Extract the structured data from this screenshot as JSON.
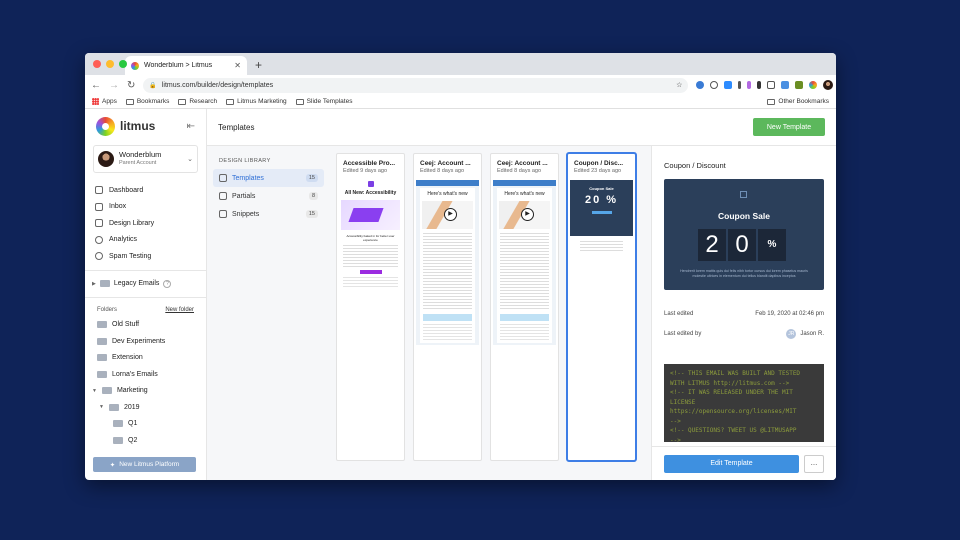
{
  "browser": {
    "tab_title": "Wonderblum > Litmus",
    "url": "litmus.com/builder/design/templates",
    "bookmarks": [
      "Apps",
      "Bookmarks",
      "Research",
      "Litmus Marketing",
      "Slide Templates"
    ],
    "other_bookmarks": "Other Bookmarks"
  },
  "sidebar": {
    "logo_text": "litmus",
    "account_name": "Wonderblum",
    "account_sub": "Parent Account",
    "nav": [
      "Dashboard",
      "Inbox",
      "Design Library",
      "Analytics",
      "Spam Testing"
    ],
    "legacy": "Legacy Emails",
    "folders_label": "Folders",
    "new_folder": "New folder",
    "folders": [
      "Old Stuff",
      "Dev Experiments",
      "Extension",
      "Lorna's Emails",
      "Marketing",
      "2019",
      "Q1",
      "Q2"
    ],
    "new_platform": "New Litmus Platform"
  },
  "topbar": {
    "title": "Templates",
    "new_template": "New Template"
  },
  "library": {
    "heading": "DESIGN LIBRARY",
    "items": [
      {
        "label": "Templates",
        "count": "15"
      },
      {
        "label": "Partials",
        "count": "8"
      },
      {
        "label": "Snippets",
        "count": "15"
      }
    ]
  },
  "cards": [
    {
      "title": "Accessible Pro...",
      "sub": "Edited 9 days ago",
      "thumb_heading": "All New: Accessibility",
      "thumb_caption": "Accessibility baked in for better user experience"
    },
    {
      "title": "Ceej: Account ...",
      "sub": "Edited 8 days ago",
      "thumb_heading": "Here's what's new"
    },
    {
      "title": "Ceej: Account ...",
      "sub": "Edited 8 days ago",
      "thumb_heading": "Here's what's new"
    },
    {
      "title": "Coupon / Disc...",
      "sub": "Edited 23 days ago",
      "thumb_heading": "Coupon Sale",
      "thumb_big": "20 %"
    }
  ],
  "panel": {
    "title": "Coupon / Discount",
    "preview_heading": "Coupon Sale",
    "digits": [
      "2",
      "0",
      "%"
    ],
    "preview_text": "Hendrerit lorem mattis quis dui felis nibh tortor cursus dui lorem phaselus mauris molestie ultrices in elementum dui tellus blandit dapibus inceptos",
    "last_edited_label": "Last edited",
    "last_edited_value": "Feb 19, 2020 at 02:46 pm",
    "last_edited_by_label": "Last edited by",
    "last_edited_by_initials": "JR",
    "last_edited_by_name": "Jason R.",
    "code": "<!-- THIS EMAIL WAS BUILT AND TESTED\nWITH LITMUS http://litmus.com -->\n<!-- IT WAS RELEASED UNDER THE MIT\nLICENSE\nhttps://opensource.org/licenses/MIT\n-->\n<!-- QUESTIONS? TWEET US @LITMUSAPP\n-->",
    "edit_button": "Edit Template",
    "more_button": "..."
  }
}
